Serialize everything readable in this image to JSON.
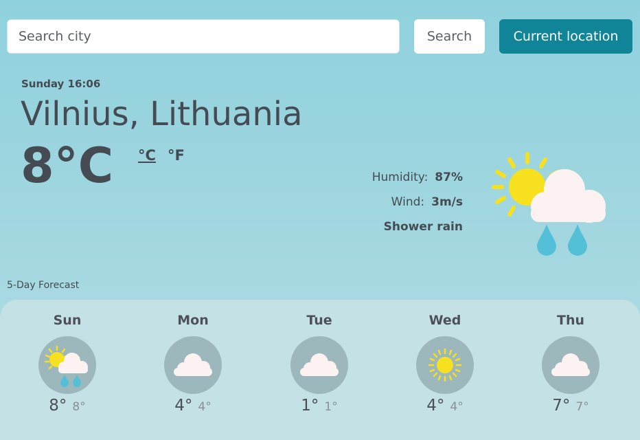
{
  "search": {
    "placeholder": "Search city",
    "button_label": "Search",
    "location_button_label": "Current location"
  },
  "current": {
    "datetime": "Sunday 16:06",
    "city": "Vilnius, Lithuania",
    "temperature": "8°C",
    "unit_celsius": "°C",
    "unit_fahrenheit": "°F",
    "humidity_label": "Humidity:",
    "humidity_value": "87%",
    "wind_label": "Wind:",
    "wind_value": "3m/s",
    "description": "Shower rain",
    "icon": "sun-cloud-rain-icon"
  },
  "forecast": {
    "label": "5-Day Forecast",
    "days": [
      {
        "name": "Sun",
        "max": "8°",
        "min": "8°",
        "icon": "sun-cloud-rain-icon"
      },
      {
        "name": "Mon",
        "max": "4°",
        "min": "4°",
        "icon": "cloud-icon"
      },
      {
        "name": "Tue",
        "max": "1°",
        "min": "1°",
        "icon": "cloud-icon"
      },
      {
        "name": "Wed",
        "max": "4°",
        "min": "4°",
        "icon": "sun-icon"
      },
      {
        "name": "Thu",
        "max": "7°",
        "min": "7°",
        "icon": "cloud-icon"
      }
    ]
  },
  "colors": {
    "accent": "#0f8597",
    "sun": "#f7e11e",
    "cloud": "#fdf2f2",
    "rain": "#54c0d8",
    "forecast_panel": "#c4e2e6",
    "icon_circle": "#9db8bd"
  }
}
